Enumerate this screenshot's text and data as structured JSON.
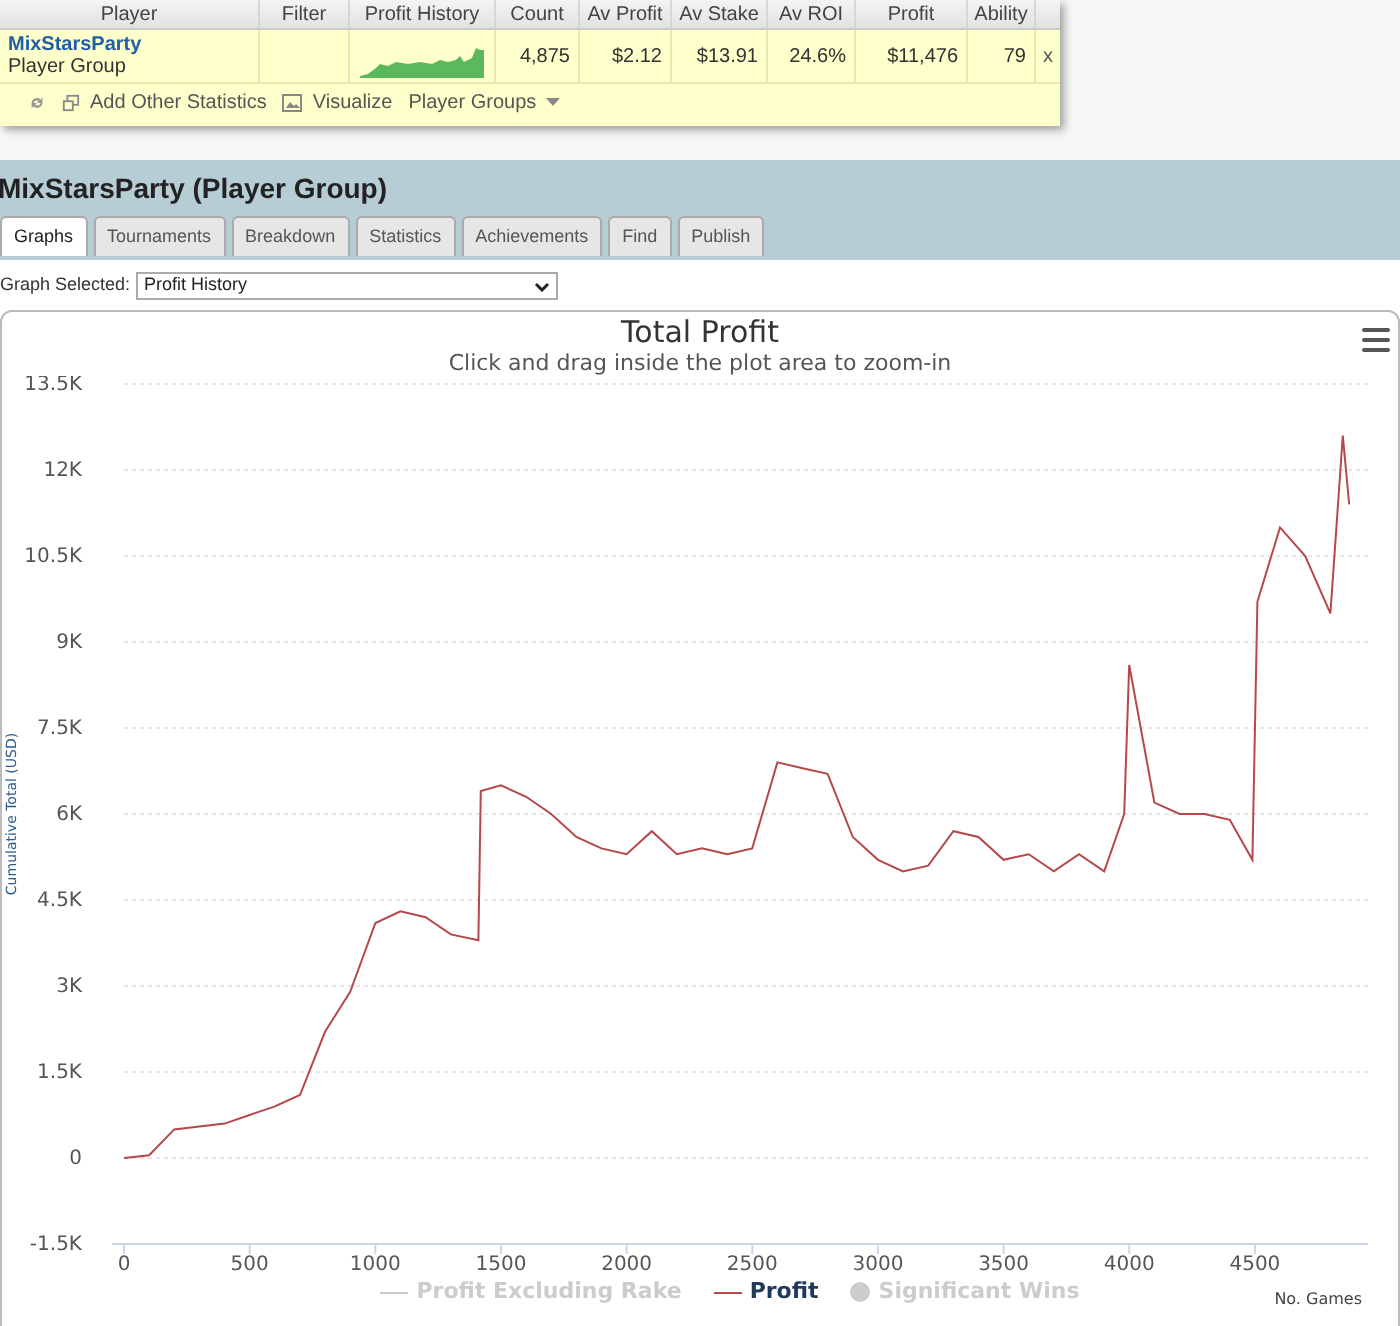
{
  "summary_table": {
    "columns": [
      "Player",
      "Filter",
      "Profit History",
      "Count",
      "Av Profit",
      "Av Stake",
      "Av ROI",
      "Profit",
      "Ability"
    ],
    "row": {
      "player": "MixStarsParty",
      "player_type": "Player Group",
      "count": "4,875",
      "av_profit": "$2.12",
      "av_stake": "$13.91",
      "av_roi": "24.6%",
      "profit": "$11,476",
      "ability": "79",
      "remove": "x"
    },
    "toolbar": [
      {
        "kind": "refresh"
      },
      {
        "kind": "add",
        "label": "Add Other Statistics"
      },
      {
        "kind": "image",
        "label": "Visualize"
      },
      {
        "kind": "dropdown",
        "label": "Player Groups"
      }
    ]
  },
  "page_title": "MixStarsParty (Player Group)",
  "tabs": [
    {
      "label": "Graphs",
      "selected": true
    },
    {
      "label": "Tournaments",
      "selected": false
    },
    {
      "label": "Breakdown",
      "selected": false
    },
    {
      "label": "Statistics",
      "selected": false
    },
    {
      "label": "Achievements",
      "selected": false
    },
    {
      "label": "Find",
      "selected": false
    },
    {
      "label": "Publish",
      "selected": false
    }
  ],
  "graph_select": {
    "label": "Graph Selected:",
    "value": "Profit History"
  },
  "chart": {
    "legend": [
      {
        "label": "Profit Excluding Rake",
        "kind": "line",
        "color": "#cccccc",
        "visible": false
      },
      {
        "kind": "series",
        "visible": true
      },
      {
        "label": "Significant Wins",
        "kind": "dot",
        "color": "#cccccc",
        "visible": false
      }
    ],
    "chart_data": {
      "type": "line",
      "grid": true,
      "title": "Total Profit",
      "subtitle": "Click and drag inside the plot area to zoom-in",
      "xlabel": "No. Games",
      "ylabel": "Cumulative Total (USD)",
      "xlim": [
        0,
        4950
      ],
      "ylim": [
        -1500,
        13500
      ],
      "xticks": [
        0,
        500,
        1000,
        1500,
        2000,
        2500,
        3000,
        3500,
        4000,
        4500
      ],
      "yticks": [
        {
          "value": -1500,
          "label": "-1.5K"
        },
        {
          "value": 0,
          "label": "0"
        },
        {
          "value": 1500,
          "label": "1.5K"
        },
        {
          "value": 3000,
          "label": "3K"
        },
        {
          "value": 4500,
          "label": "4.5K"
        },
        {
          "value": 6000,
          "label": "6K"
        },
        {
          "value": 7500,
          "label": "7.5K"
        },
        {
          "value": 9000,
          "label": "9K"
        },
        {
          "value": 10500,
          "label": "10.5K"
        },
        {
          "value": 12000,
          "label": "12K"
        },
        {
          "value": 13500,
          "label": "13.5K"
        }
      ],
      "x": [
        0,
        100,
        200,
        300,
        400,
        500,
        600,
        700,
        800,
        900,
        1000,
        1100,
        1200,
        1300,
        1410,
        1420,
        1500,
        1600,
        1700,
        1800,
        1900,
        2000,
        2100,
        2200,
        2300,
        2400,
        2500,
        2600,
        2700,
        2800,
        2900,
        3000,
        3100,
        3200,
        3300,
        3400,
        3500,
        3600,
        3700,
        3800,
        3900,
        3980,
        4000,
        4100,
        4200,
        4300,
        4400,
        4490,
        4510,
        4600,
        4700,
        4800,
        4850,
        4875
      ],
      "series": [
        {
          "name": "Profit",
          "color": "#b5484a",
          "values": [
            0,
            50,
            500,
            550,
            600,
            750,
            900,
            1100,
            2200,
            2900,
            4100,
            4300,
            4200,
            3900,
            3800,
            6400,
            6500,
            6300,
            6000,
            5600,
            5400,
            5300,
            5700,
            5300,
            5400,
            5300,
            5400,
            6900,
            6800,
            6700,
            5600,
            5200,
            5000,
            5100,
            5700,
            5600,
            5200,
            5300,
            5000,
            5300,
            5000,
            6000,
            8600,
            6200,
            6000,
            6000,
            5900,
            5200,
            9700,
            11000,
            10500,
            9500,
            12600,
            11400
          ]
        }
      ]
    }
  }
}
